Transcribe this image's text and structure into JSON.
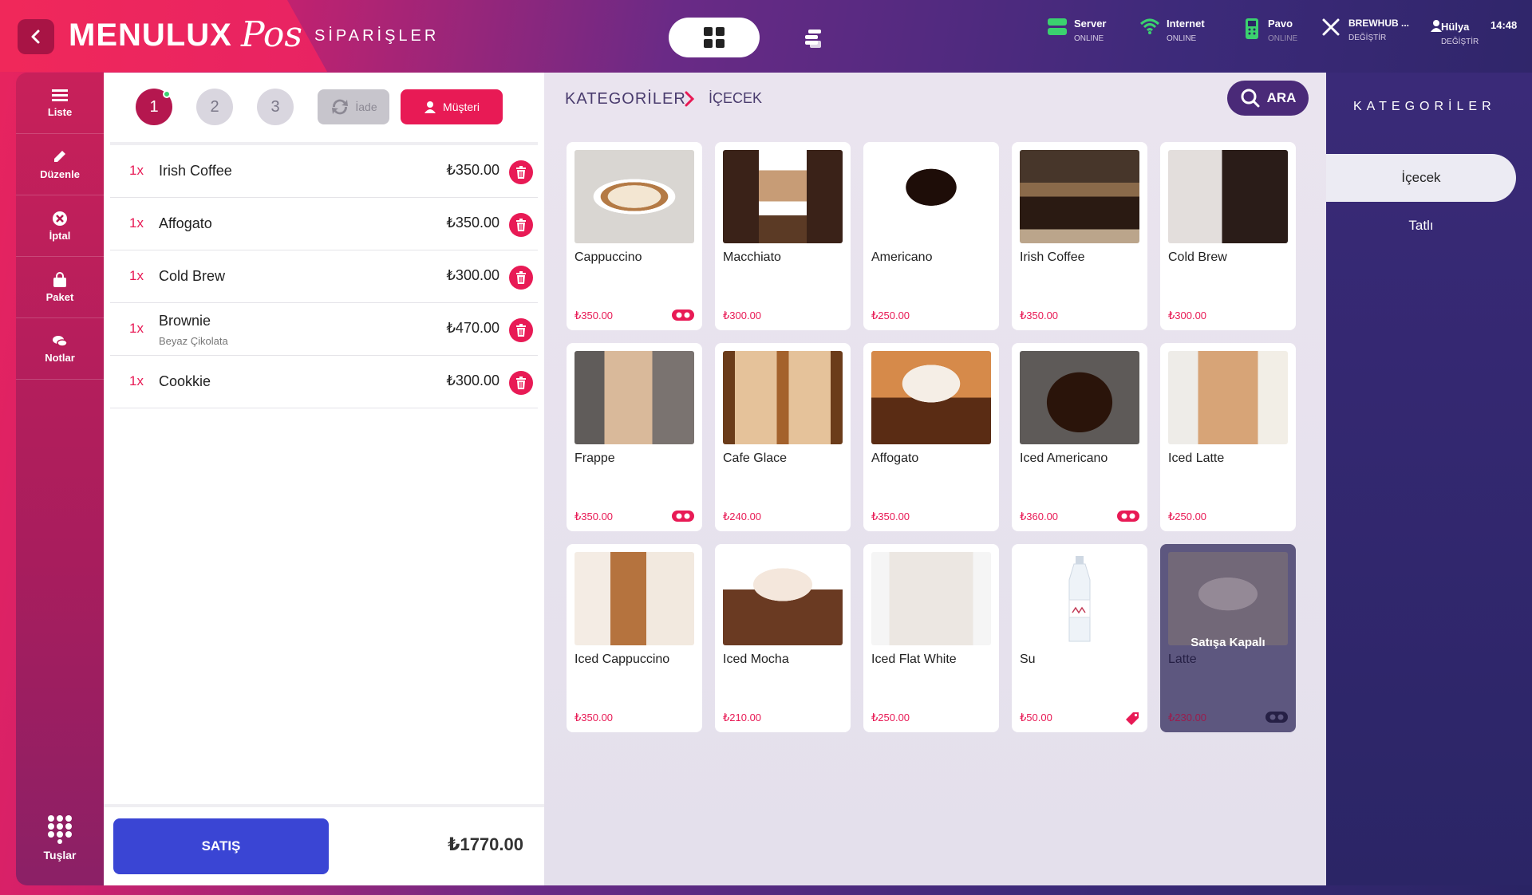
{
  "header": {
    "logo_text": "MENULUX",
    "logo_pos": "Pos",
    "page_title": "SİPARİŞLER",
    "status": [
      {
        "label": "Server",
        "sub": "ONLINE",
        "icon": "server-icon"
      },
      {
        "label": "Internet",
        "sub": "ONLINE",
        "icon": "wifi-icon"
      },
      {
        "label": "Pavo",
        "sub": "ONLINE",
        "icon": "pos-device-icon"
      },
      {
        "label": "BREWHUB ...",
        "sub": "DEĞİŞTİR",
        "icon": "restaurant-icon"
      },
      {
        "label": "Hülya",
        "sub": "DEĞİŞTİR",
        "icon": "user-icon"
      }
    ],
    "clock": "14:48"
  },
  "leftnav": {
    "items": [
      {
        "label": "Liste",
        "icon": "menu-icon"
      },
      {
        "label": "Düzenle",
        "icon": "pencil-icon"
      },
      {
        "label": "İptal",
        "icon": "cancel-icon"
      },
      {
        "label": "Paket",
        "icon": "bag-icon"
      },
      {
        "label": "Notlar",
        "icon": "notes-icon"
      }
    ],
    "keys_label": "Tuşlar"
  },
  "order": {
    "tabs": [
      "1",
      "2",
      "3"
    ],
    "iade_label": "İade",
    "musteri_label": "Müşteri",
    "lines": [
      {
        "qty": "1x",
        "name": "Irish Coffee",
        "note": "",
        "price": "₺350.00"
      },
      {
        "qty": "1x",
        "name": "Affogato",
        "note": "",
        "price": "₺350.00"
      },
      {
        "qty": "1x",
        "name": "Cold Brew",
        "note": "",
        "price": "₺300.00"
      },
      {
        "qty": "1x",
        "name": "Brownie",
        "note": "Beyaz Çikolata",
        "price": "₺470.00"
      },
      {
        "qty": "1x",
        "name": "Cookkie",
        "note": "",
        "price": "₺300.00"
      }
    ],
    "satis_label": "SATIŞ",
    "total": "₺1770.00"
  },
  "main": {
    "breadcrumb_root": "KATEGORİLER",
    "breadcrumb_current": "İÇECEK",
    "search_label": "ARA",
    "closed_label": "Satışa Kapalı",
    "products": [
      {
        "name": "Cappuccino",
        "price": "₺350.00",
        "badge": "toggle"
      },
      {
        "name": "Macchiato",
        "price": "₺300.00",
        "badge": ""
      },
      {
        "name": "Americano",
        "price": "₺250.00",
        "badge": ""
      },
      {
        "name": "Irish Coffee",
        "price": "₺350.00",
        "badge": ""
      },
      {
        "name": "Cold Brew",
        "price": "₺300.00",
        "badge": ""
      },
      {
        "name": "Frappe",
        "price": "₺350.00",
        "badge": "toggle"
      },
      {
        "name": "Cafe Glace",
        "price": "₺240.00",
        "badge": ""
      },
      {
        "name": "Affogato",
        "price": "₺350.00",
        "badge": ""
      },
      {
        "name": "Iced Americano",
        "price": "₺360.00",
        "badge": "toggle"
      },
      {
        "name": "Iced Latte",
        "price": "₺250.00",
        "badge": ""
      },
      {
        "name": "Iced Cappuccino",
        "price": "₺350.00",
        "badge": ""
      },
      {
        "name": "Iced Mocha",
        "price": "₺210.00",
        "badge": ""
      },
      {
        "name": "Iced Flat White",
        "price": "₺250.00",
        "badge": ""
      },
      {
        "name": "Su",
        "price": "₺50.00",
        "badge": "tag"
      },
      {
        "name": "Latte",
        "price": "₺230.00",
        "badge": "toggle",
        "closed": true
      }
    ]
  },
  "categories": {
    "title": "KATEGORİLER",
    "items": [
      {
        "label": "İçecek",
        "active": true
      },
      {
        "label": "Tatlı",
        "active": false
      }
    ]
  },
  "colors": {
    "accent": "#e81a55",
    "sale_button": "#3a45d4",
    "search_button": "#4a2a78",
    "online_green": "#3bd16f"
  }
}
